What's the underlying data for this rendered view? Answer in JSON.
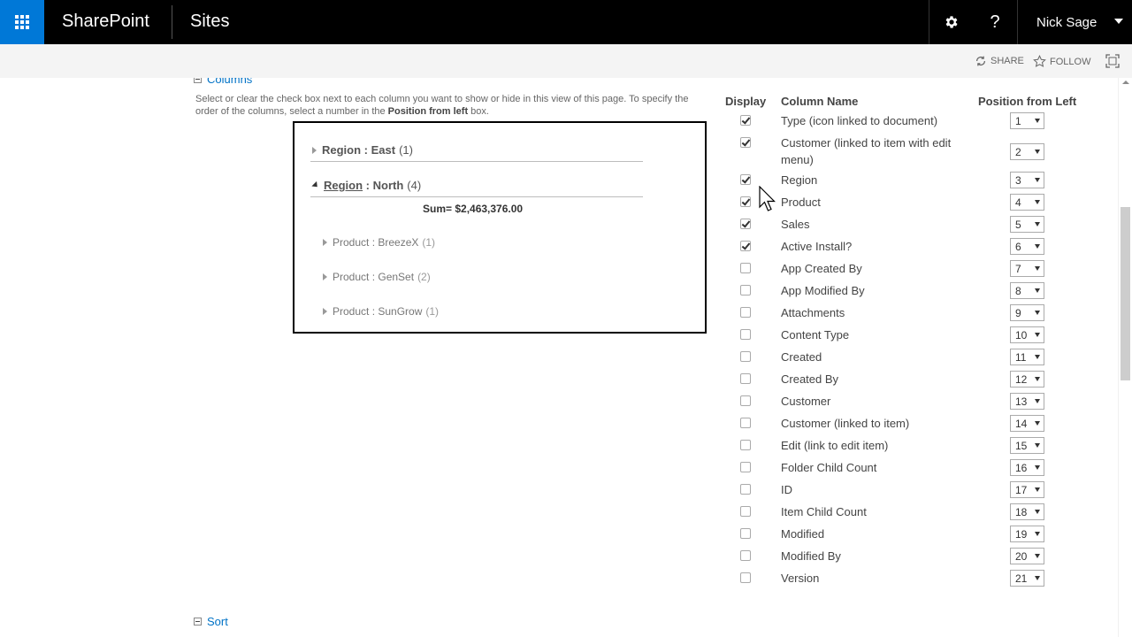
{
  "suitebar": {
    "brand": "SharePoint",
    "sites": "Sites",
    "user": "Nick Sage",
    "help": "?"
  },
  "actions": {
    "share": "SHARE",
    "follow": "FOLLOW"
  },
  "columns_section": {
    "title": "Columns",
    "desc_before": "Select or clear the check box next to each column you want to show or hide in this view of this page. To specify the order of the columns, select a number in the ",
    "desc_bold": "Position from left",
    "desc_after": " box."
  },
  "preview": {
    "groups": [
      {
        "label": "Region",
        "sep": " : ",
        "value": "East",
        "count": "(1)"
      },
      {
        "label": "Region",
        "sep": " : ",
        "value": "North",
        "count": "(4)"
      }
    ],
    "sum": "Sum= $2,463,376.00",
    "subgroups": [
      {
        "label": "Product : BreezeX",
        "count": "(1)"
      },
      {
        "label": "Product : GenSet",
        "count": "(2)"
      },
      {
        "label": "Product : SunGrow",
        "count": "(1)"
      }
    ]
  },
  "table": {
    "headers": {
      "display": "Display",
      "name": "Column Name",
      "position": "Position from Left"
    },
    "rows": [
      {
        "name": "Type (icon linked to document)",
        "checked": true,
        "pos": "1"
      },
      {
        "name": "Customer (linked to item with edit menu)",
        "checked": true,
        "pos": "2"
      },
      {
        "name": "Region",
        "checked": true,
        "pos": "3"
      },
      {
        "name": "Product",
        "checked": true,
        "pos": "4"
      },
      {
        "name": "Sales",
        "checked": true,
        "pos": "5"
      },
      {
        "name": "Active Install?",
        "checked": true,
        "pos": "6"
      },
      {
        "name": "App Created By",
        "checked": false,
        "pos": "7"
      },
      {
        "name": "App Modified By",
        "checked": false,
        "pos": "8"
      },
      {
        "name": "Attachments",
        "checked": false,
        "pos": "9"
      },
      {
        "name": "Content Type",
        "checked": false,
        "pos": "10"
      },
      {
        "name": "Created",
        "checked": false,
        "pos": "11"
      },
      {
        "name": "Created By",
        "checked": false,
        "pos": "12"
      },
      {
        "name": "Customer",
        "checked": false,
        "pos": "13"
      },
      {
        "name": "Customer (linked to item)",
        "checked": false,
        "pos": "14"
      },
      {
        "name": "Edit (link to edit item)",
        "checked": false,
        "pos": "15"
      },
      {
        "name": "Folder Child Count",
        "checked": false,
        "pos": "16"
      },
      {
        "name": "ID",
        "checked": false,
        "pos": "17"
      },
      {
        "name": "Item Child Count",
        "checked": false,
        "pos": "18"
      },
      {
        "name": "Modified",
        "checked": false,
        "pos": "19"
      },
      {
        "name": "Modified By",
        "checked": false,
        "pos": "20"
      },
      {
        "name": "Version",
        "checked": false,
        "pos": "21"
      }
    ]
  },
  "sort_section": {
    "title": "Sort"
  },
  "icons": {
    "app_launcher": "waffle-icon",
    "settings": "gear-icon",
    "share": "sync-icon",
    "follow": "star-icon",
    "focus": "focus-mode-icon"
  }
}
